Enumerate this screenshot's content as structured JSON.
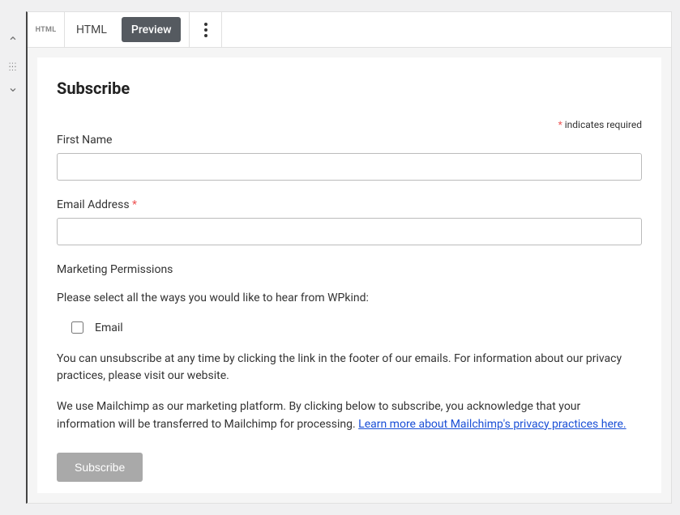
{
  "sidebar": {
    "up_icon": "chevron-up",
    "drag_icon": "drag-handle",
    "down_icon": "chevron-down"
  },
  "toolbar": {
    "block_icon_label": "HTML",
    "tabs": [
      {
        "label": "HTML",
        "active": false
      },
      {
        "label": "Preview",
        "active": true
      }
    ]
  },
  "form": {
    "title": "Subscribe",
    "required_note": "indicates required",
    "fields": {
      "first_name": {
        "label": "First Name",
        "required": false,
        "value": ""
      },
      "email": {
        "label": "Email Address",
        "required": true,
        "value": ""
      }
    },
    "marketing": {
      "heading": "Marketing Permissions",
      "instruction": "Please select all the ways you would like to hear from WPkind:",
      "options": [
        {
          "label": "Email",
          "checked": false
        }
      ],
      "unsubscribe_text": "You can unsubscribe at any time by clicking the link in the footer of our emails. For information about our privacy practices, please visit our website.",
      "mailchimp_text": "We use Mailchimp as our marketing platform. By clicking below to subscribe, you acknowledge that your information will be transferred to Mailchimp for processing. ",
      "mailchimp_link_text": "Learn more about Mailchimp's privacy practices here."
    },
    "submit_label": "Subscribe"
  }
}
